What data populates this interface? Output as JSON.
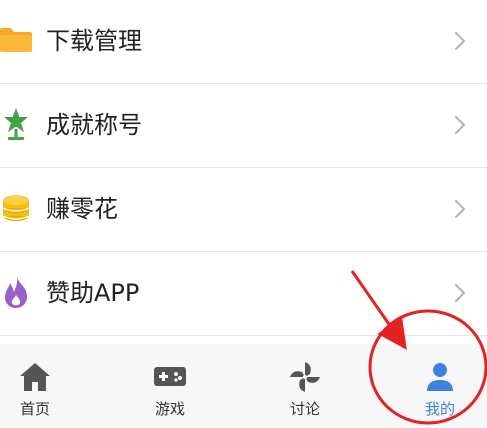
{
  "menu": {
    "items": [
      {
        "label": "下载管理",
        "icon": "folder-icon"
      },
      {
        "label": "成就称号",
        "icon": "trophy-star-icon"
      },
      {
        "label": "赚零花",
        "icon": "coin-stack-icon"
      },
      {
        "label": "赞助APP",
        "icon": "flame-icon"
      }
    ]
  },
  "tabbar": {
    "tabs": [
      {
        "label": "首页",
        "icon": "home-icon",
        "active": false
      },
      {
        "label": "游戏",
        "icon": "gamepad-icon",
        "active": false
      },
      {
        "label": "讨论",
        "icon": "pinwheel-icon",
        "active": false
      },
      {
        "label": "我的",
        "icon": "user-icon",
        "active": true
      }
    ]
  },
  "colors": {
    "folder": "#f9a825",
    "star": "#43a047",
    "coin": "#f2c200",
    "flame": "#9c5fc7",
    "active_tab": "#3f82e6",
    "tab_icon": "#555555",
    "annotation": "#e32222"
  }
}
